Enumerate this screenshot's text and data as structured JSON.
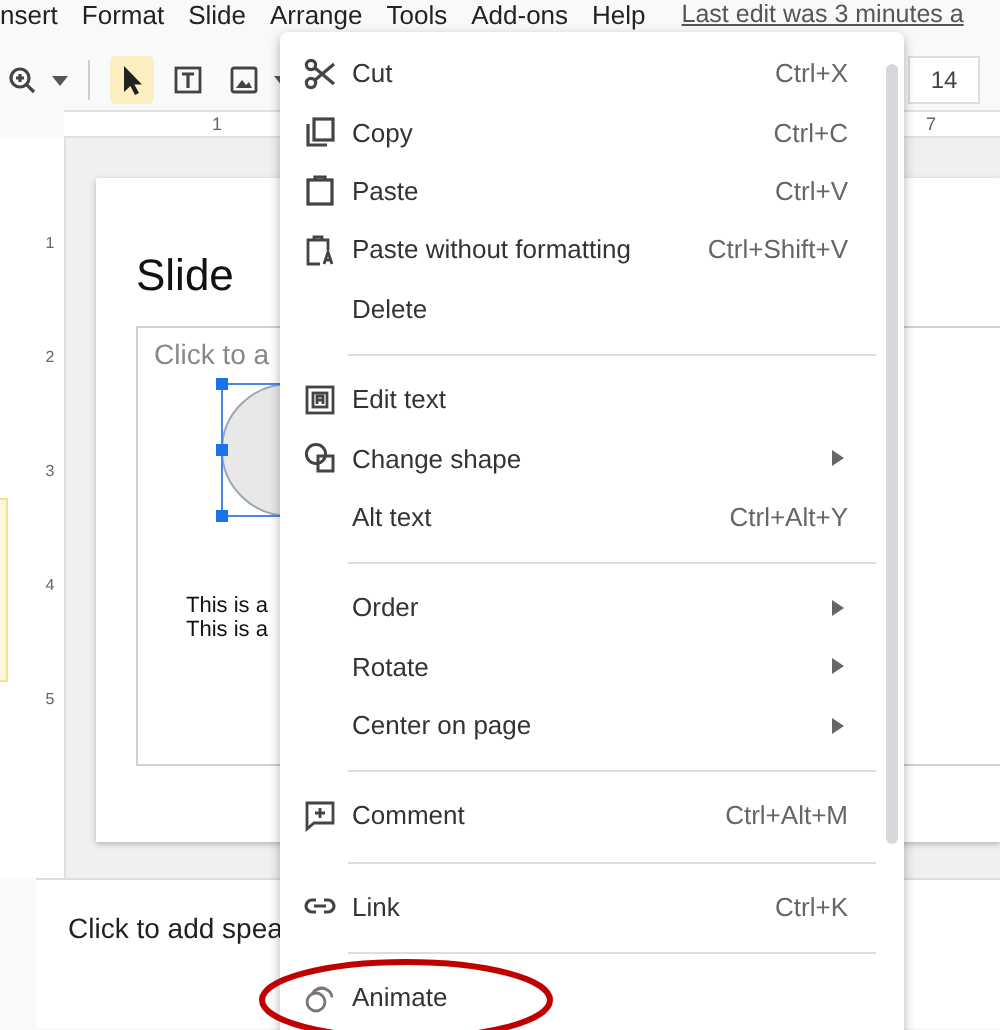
{
  "menu_bar": {
    "items": [
      "nsert",
      "Format",
      "Slide",
      "Arrange",
      "Tools",
      "Add-ons",
      "Help"
    ],
    "last_edit": "Last edit was 3 minutes a"
  },
  "toolbar": {
    "tools": [
      {
        "kind": "zoom",
        "selected": false
      },
      {
        "kind": "select",
        "selected": true
      },
      {
        "kind": "textbox",
        "selected": false
      },
      {
        "kind": "image",
        "selected": false
      }
    ],
    "font_size": "14"
  },
  "ruler": {
    "top_labels": [
      "1",
      "7"
    ],
    "side_labels": [
      "1",
      "2",
      "3",
      "4",
      "5"
    ]
  },
  "slide": {
    "title": "Slide",
    "placeholder": "Click to a",
    "lines": [
      "This is a",
      "This is a"
    ]
  },
  "notes": {
    "placeholder": "Click to add spea"
  },
  "context_menu": {
    "sections": [
      [
        {
          "label": "Cut",
          "shortcut": "Ctrl+X",
          "submenu": false
        },
        {
          "label": "Copy",
          "shortcut": "Ctrl+C",
          "submenu": false
        },
        {
          "label": "Paste",
          "shortcut": "Ctrl+V",
          "submenu": false
        },
        {
          "label": "Paste without formatting",
          "shortcut": "Ctrl+Shift+V",
          "submenu": false
        },
        {
          "label": "Delete",
          "submenu": false
        }
      ],
      [
        {
          "label": "Edit text",
          "submenu": false
        },
        {
          "label": "Change shape",
          "submenu": true
        },
        {
          "label": "Alt text",
          "shortcut": "Ctrl+Alt+Y",
          "submenu": false
        }
      ],
      [
        {
          "label": "Order",
          "submenu": true
        },
        {
          "label": "Rotate",
          "submenu": true
        },
        {
          "label": "Center on page",
          "submenu": true
        }
      ],
      [
        {
          "label": "Comment",
          "shortcut": "Ctrl+Alt+M",
          "submenu": false
        }
      ],
      [
        {
          "label": "Link",
          "shortcut": "Ctrl+K",
          "submenu": false
        }
      ],
      [
        {
          "label": "Animate",
          "submenu": false
        }
      ]
    ]
  }
}
